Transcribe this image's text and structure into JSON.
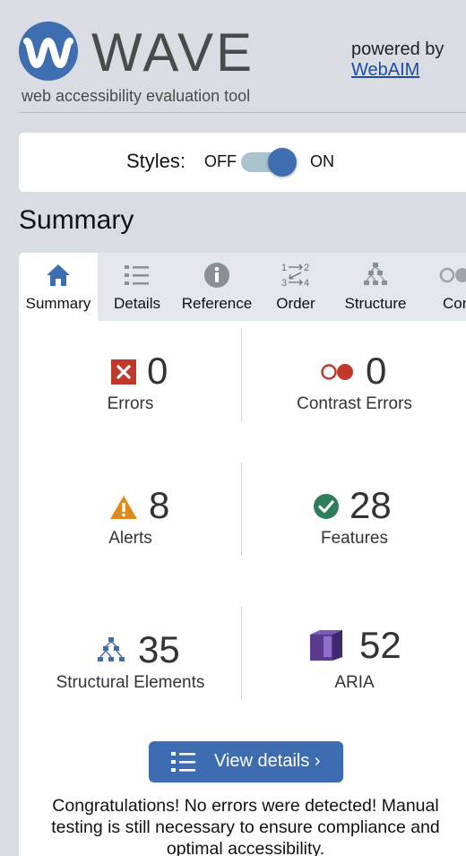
{
  "header": {
    "logo_text": "WAVE",
    "tagline": "web accessibility evaluation tool",
    "powered_by": "powered by",
    "webaim_link": "WebAIM"
  },
  "styles_toggle": {
    "label": "Styles:",
    "off": "OFF",
    "on": "ON",
    "state": "on"
  },
  "page_title": "Summary",
  "tabs": [
    {
      "label": "Summary",
      "icon": "home-icon",
      "active": true
    },
    {
      "label": "Details",
      "icon": "details-list-icon"
    },
    {
      "label": "Reference",
      "icon": "info-icon"
    },
    {
      "label": "Order",
      "icon": "order-icon"
    },
    {
      "label": "Structure",
      "icon": "structure-icon"
    },
    {
      "label": "Contra",
      "icon": "contrast-icon"
    }
  ],
  "stats": {
    "errors": {
      "count": "0",
      "label": "Errors",
      "icon": "error-x-icon",
      "color": "#c0392b"
    },
    "contrast_errors": {
      "count": "0",
      "label": "Contrast Errors",
      "icon": "contrast-error-icon",
      "color": "#c0392b"
    },
    "alerts": {
      "count": "8",
      "label": "Alerts",
      "icon": "alert-triangle-icon",
      "color": "#e08a1e"
    },
    "features": {
      "count": "28",
      "label": "Features",
      "icon": "feature-check-icon",
      "color": "#2e7d5b"
    },
    "structural": {
      "count": "35",
      "label": "Structural Elements",
      "icon": "structure-icon",
      "color": "#3f6eb0"
    },
    "aria": {
      "count": "52",
      "label": "ARIA",
      "icon": "aria-cube-icon",
      "color": "#5a3a91"
    }
  },
  "view_details_button": "View details ›",
  "congrats_text": "Congratulations! No errors were detected! Manual testing is still necessary to ensure compliance and optimal accessibility."
}
